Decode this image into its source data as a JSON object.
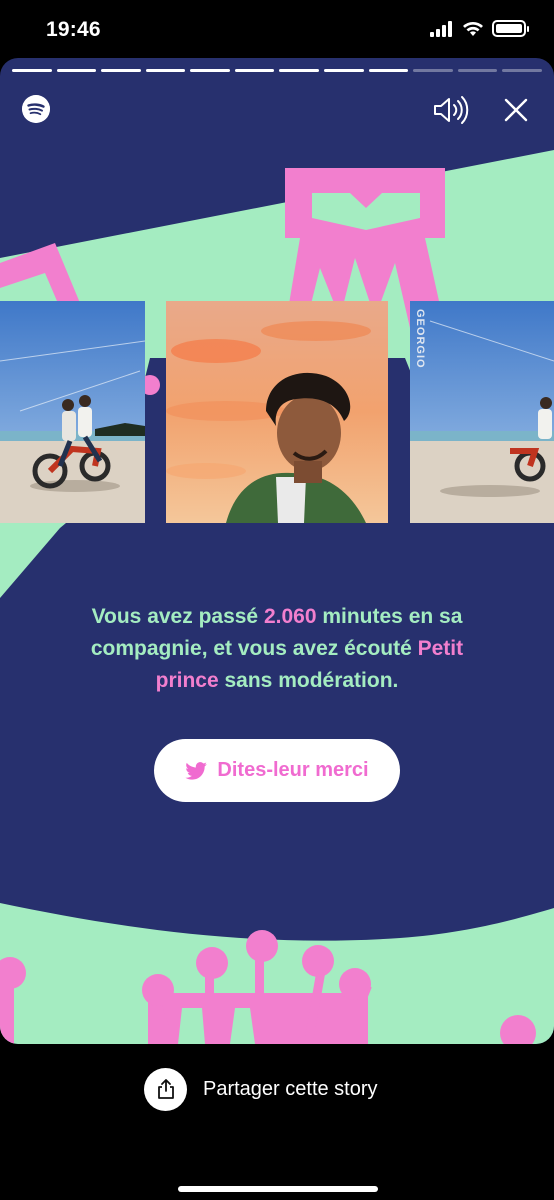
{
  "status_bar": {
    "time": "19:46",
    "icons": [
      "signal-icon",
      "wifi-icon",
      "battery-icon"
    ]
  },
  "story": {
    "progress": {
      "segments": 12,
      "completed": 9
    },
    "top_bar": {
      "logo": "spotify-logo-icon",
      "sound": "speaker-icon",
      "close": "close-icon"
    },
    "covers": [
      {
        "description": "motorcycle-beach-cover",
        "side": "left"
      },
      {
        "description": "portrait-sunset-cover",
        "side": "center"
      },
      {
        "description": "motorcycle-beach-cover",
        "side": "right",
        "tag": "GEORGIO"
      }
    ],
    "text": {
      "part1": "Vous avez passé ",
      "minutes": "2.060",
      "part2": " minutes en sa compagnie, et vous avez écouté ",
      "song": "Petit prince",
      "part3": " sans modération."
    },
    "thanks_button": {
      "label": "Dites-leur merci",
      "icon": "twitter-icon"
    },
    "colors": {
      "background": "#27306e",
      "mint": "#a4ecc1",
      "pink": "#f27fce"
    }
  },
  "share": {
    "label": "Partager cette story",
    "icon": "share-icon"
  }
}
